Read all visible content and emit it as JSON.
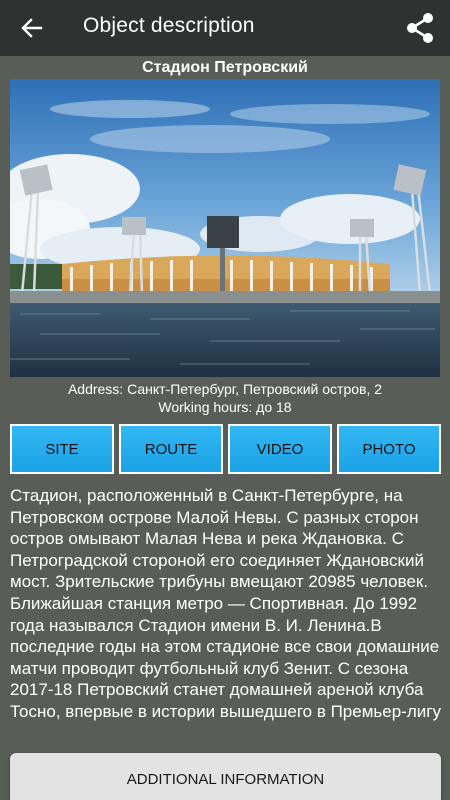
{
  "appbar": {
    "title": "Object description",
    "back_icon": "arrow-left-icon",
    "share_icon": "share-icon"
  },
  "object": {
    "name": "Стадион Петровский",
    "photo_alt": "stadium-photo",
    "address": "Address: Санкт-Петербург, Петровский остров, 2",
    "hours": "Working hours: до 18"
  },
  "buttons": {
    "site": "SITE",
    "route": "ROUTE",
    "video": "VIDEO",
    "photo": "PHOTO"
  },
  "description": "Стадион, расположенный в Санкт-Петербурге, на Петровском острове Малой Невы. С разных сторон остров омывают Малая Нева и река Ждановка. С Петроградской стороной его соединяет Ждановский мост. Зрительские трибуны вмещают 20985 человек. Ближайшая станция метро — Спортивная. До 1992 года назывался Стадион имени В. И. Ленина.В последние годы на этом стадионе все свои домашние матчи проводит футбольный клуб Зенит. С сезона 2017-18 Петровский станет домашней ареной клуба Тосно, впервые в истории вышедшего в Премьер-лигу",
  "additional_button": "ADDITIONAL INFORMATION",
  "colors": {
    "appbar": "#2f3230",
    "background": "#585d58",
    "button_blue": "#29aef0",
    "additional_button": "#e3e3e3"
  }
}
